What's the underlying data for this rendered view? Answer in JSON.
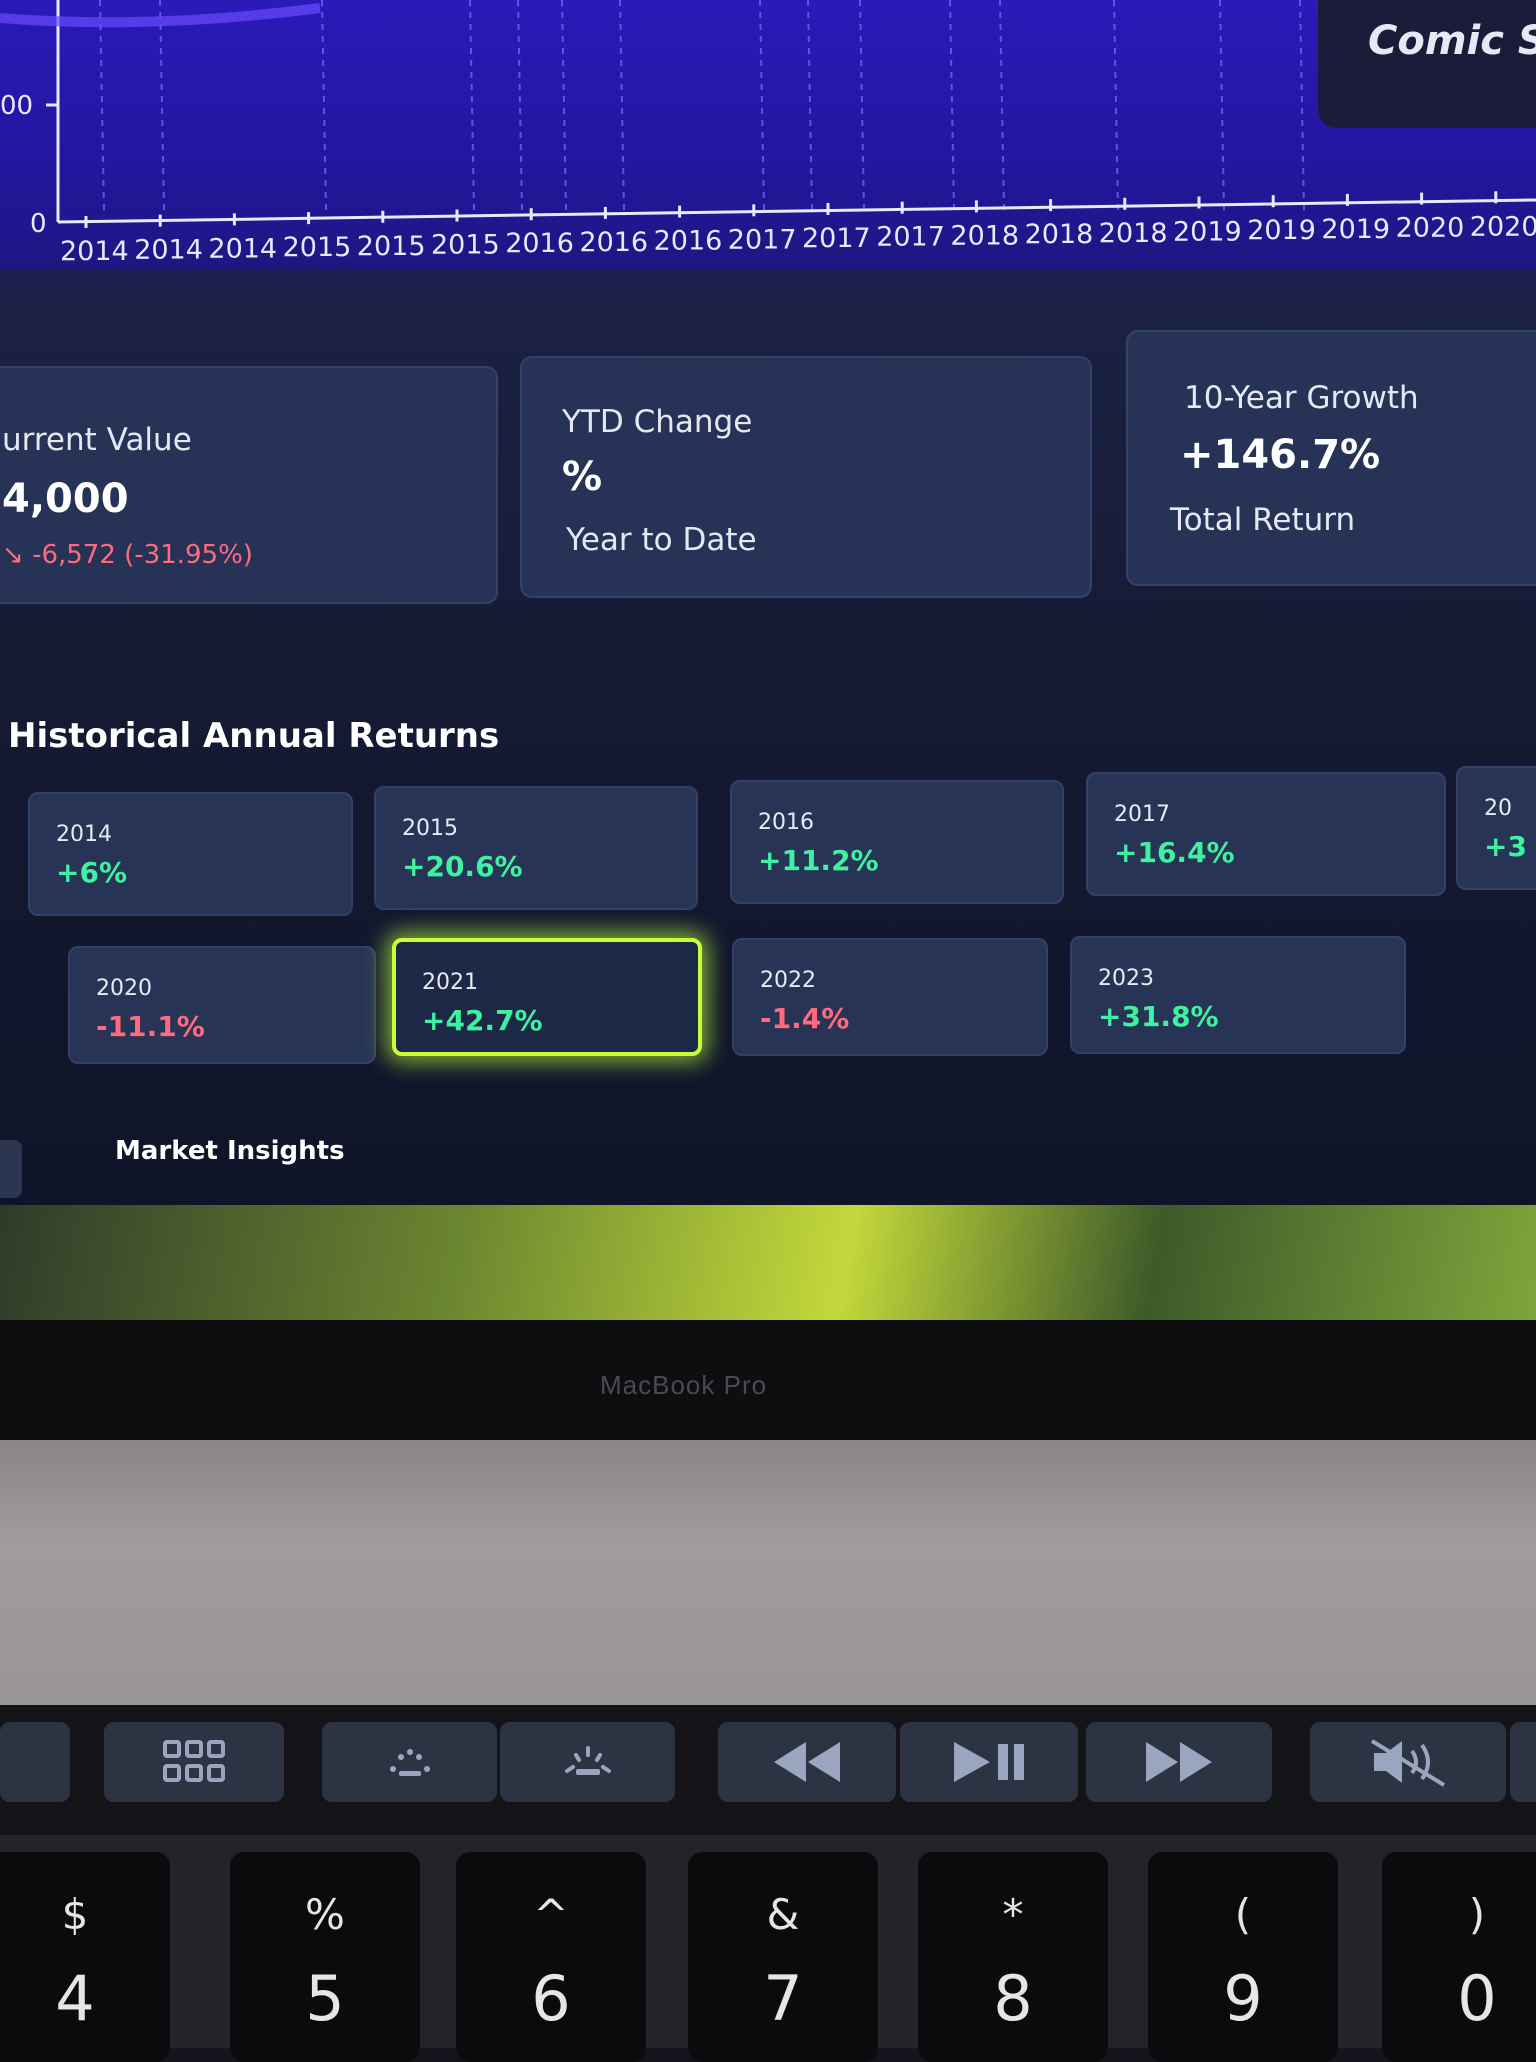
{
  "chart": {
    "y_tick_labels": [
      "00",
      "0"
    ],
    "x_tick_labels": [
      "2014",
      "2014",
      "2014",
      "2015",
      "2015",
      "2015",
      "2016",
      "2016",
      "2016",
      "2017",
      "2017",
      "2017",
      "2018",
      "2018",
      "2018",
      "2019",
      "2019",
      "2019",
      "2020",
      "2020"
    ],
    "badge_text": "Comic Spe"
  },
  "summary_cards": {
    "current_value": {
      "label": "urrent Value",
      "value": "4,000",
      "change": "-6,572 (-31.95%)"
    },
    "ytd": {
      "label": "YTD Change",
      "value": "%",
      "sublabel": "Year to Date"
    },
    "growth": {
      "label": "10-Year Growth",
      "value": "+146.7%",
      "sublabel": "Total Return"
    }
  },
  "historical": {
    "title": "Historical Annual Returns",
    "years": [
      {
        "year": "2014",
        "return": "+6%",
        "sign": "pos"
      },
      {
        "year": "2015",
        "return": "+20.6%",
        "sign": "pos"
      },
      {
        "year": "2016",
        "return": "+11.2%",
        "sign": "pos"
      },
      {
        "year": "2017",
        "return": "+16.4%",
        "sign": "pos"
      },
      {
        "year": "20",
        "return": "+3",
        "sign": "pos"
      },
      {
        "year": "2020",
        "return": "-11.1%",
        "sign": "neg"
      },
      {
        "year": "2021",
        "return": "+42.7%",
        "sign": "pos",
        "highlighted": true
      },
      {
        "year": "2022",
        "return": "-1.4%",
        "sign": "neg"
      },
      {
        "year": "2023",
        "return": "+31.8%",
        "sign": "pos"
      }
    ]
  },
  "insights": {
    "title": "Market Insights"
  },
  "hardware": {
    "brand": "MacBook Pro",
    "touchbar_icons": [
      "launchpad-icon",
      "keyboard-brightness-down-icon",
      "keyboard-brightness-up-icon",
      "rewind-icon",
      "play-pause-icon",
      "fast-forward-icon",
      "mute-icon"
    ],
    "keys": [
      {
        "top": "$",
        "bottom": "4"
      },
      {
        "top": "%",
        "bottom": "5"
      },
      {
        "top": "^",
        "bottom": "6"
      },
      {
        "top": "&",
        "bottom": "7"
      },
      {
        "top": "*",
        "bottom": "8"
      },
      {
        "top": "(",
        "bottom": "9"
      },
      {
        "top": ")",
        "bottom": "0"
      }
    ]
  },
  "colors": {
    "positive": "#3ff1a1",
    "negative": "#ff6b7d",
    "accent_purple": "#8b5cf6",
    "highlight": "#c6ff3a"
  }
}
